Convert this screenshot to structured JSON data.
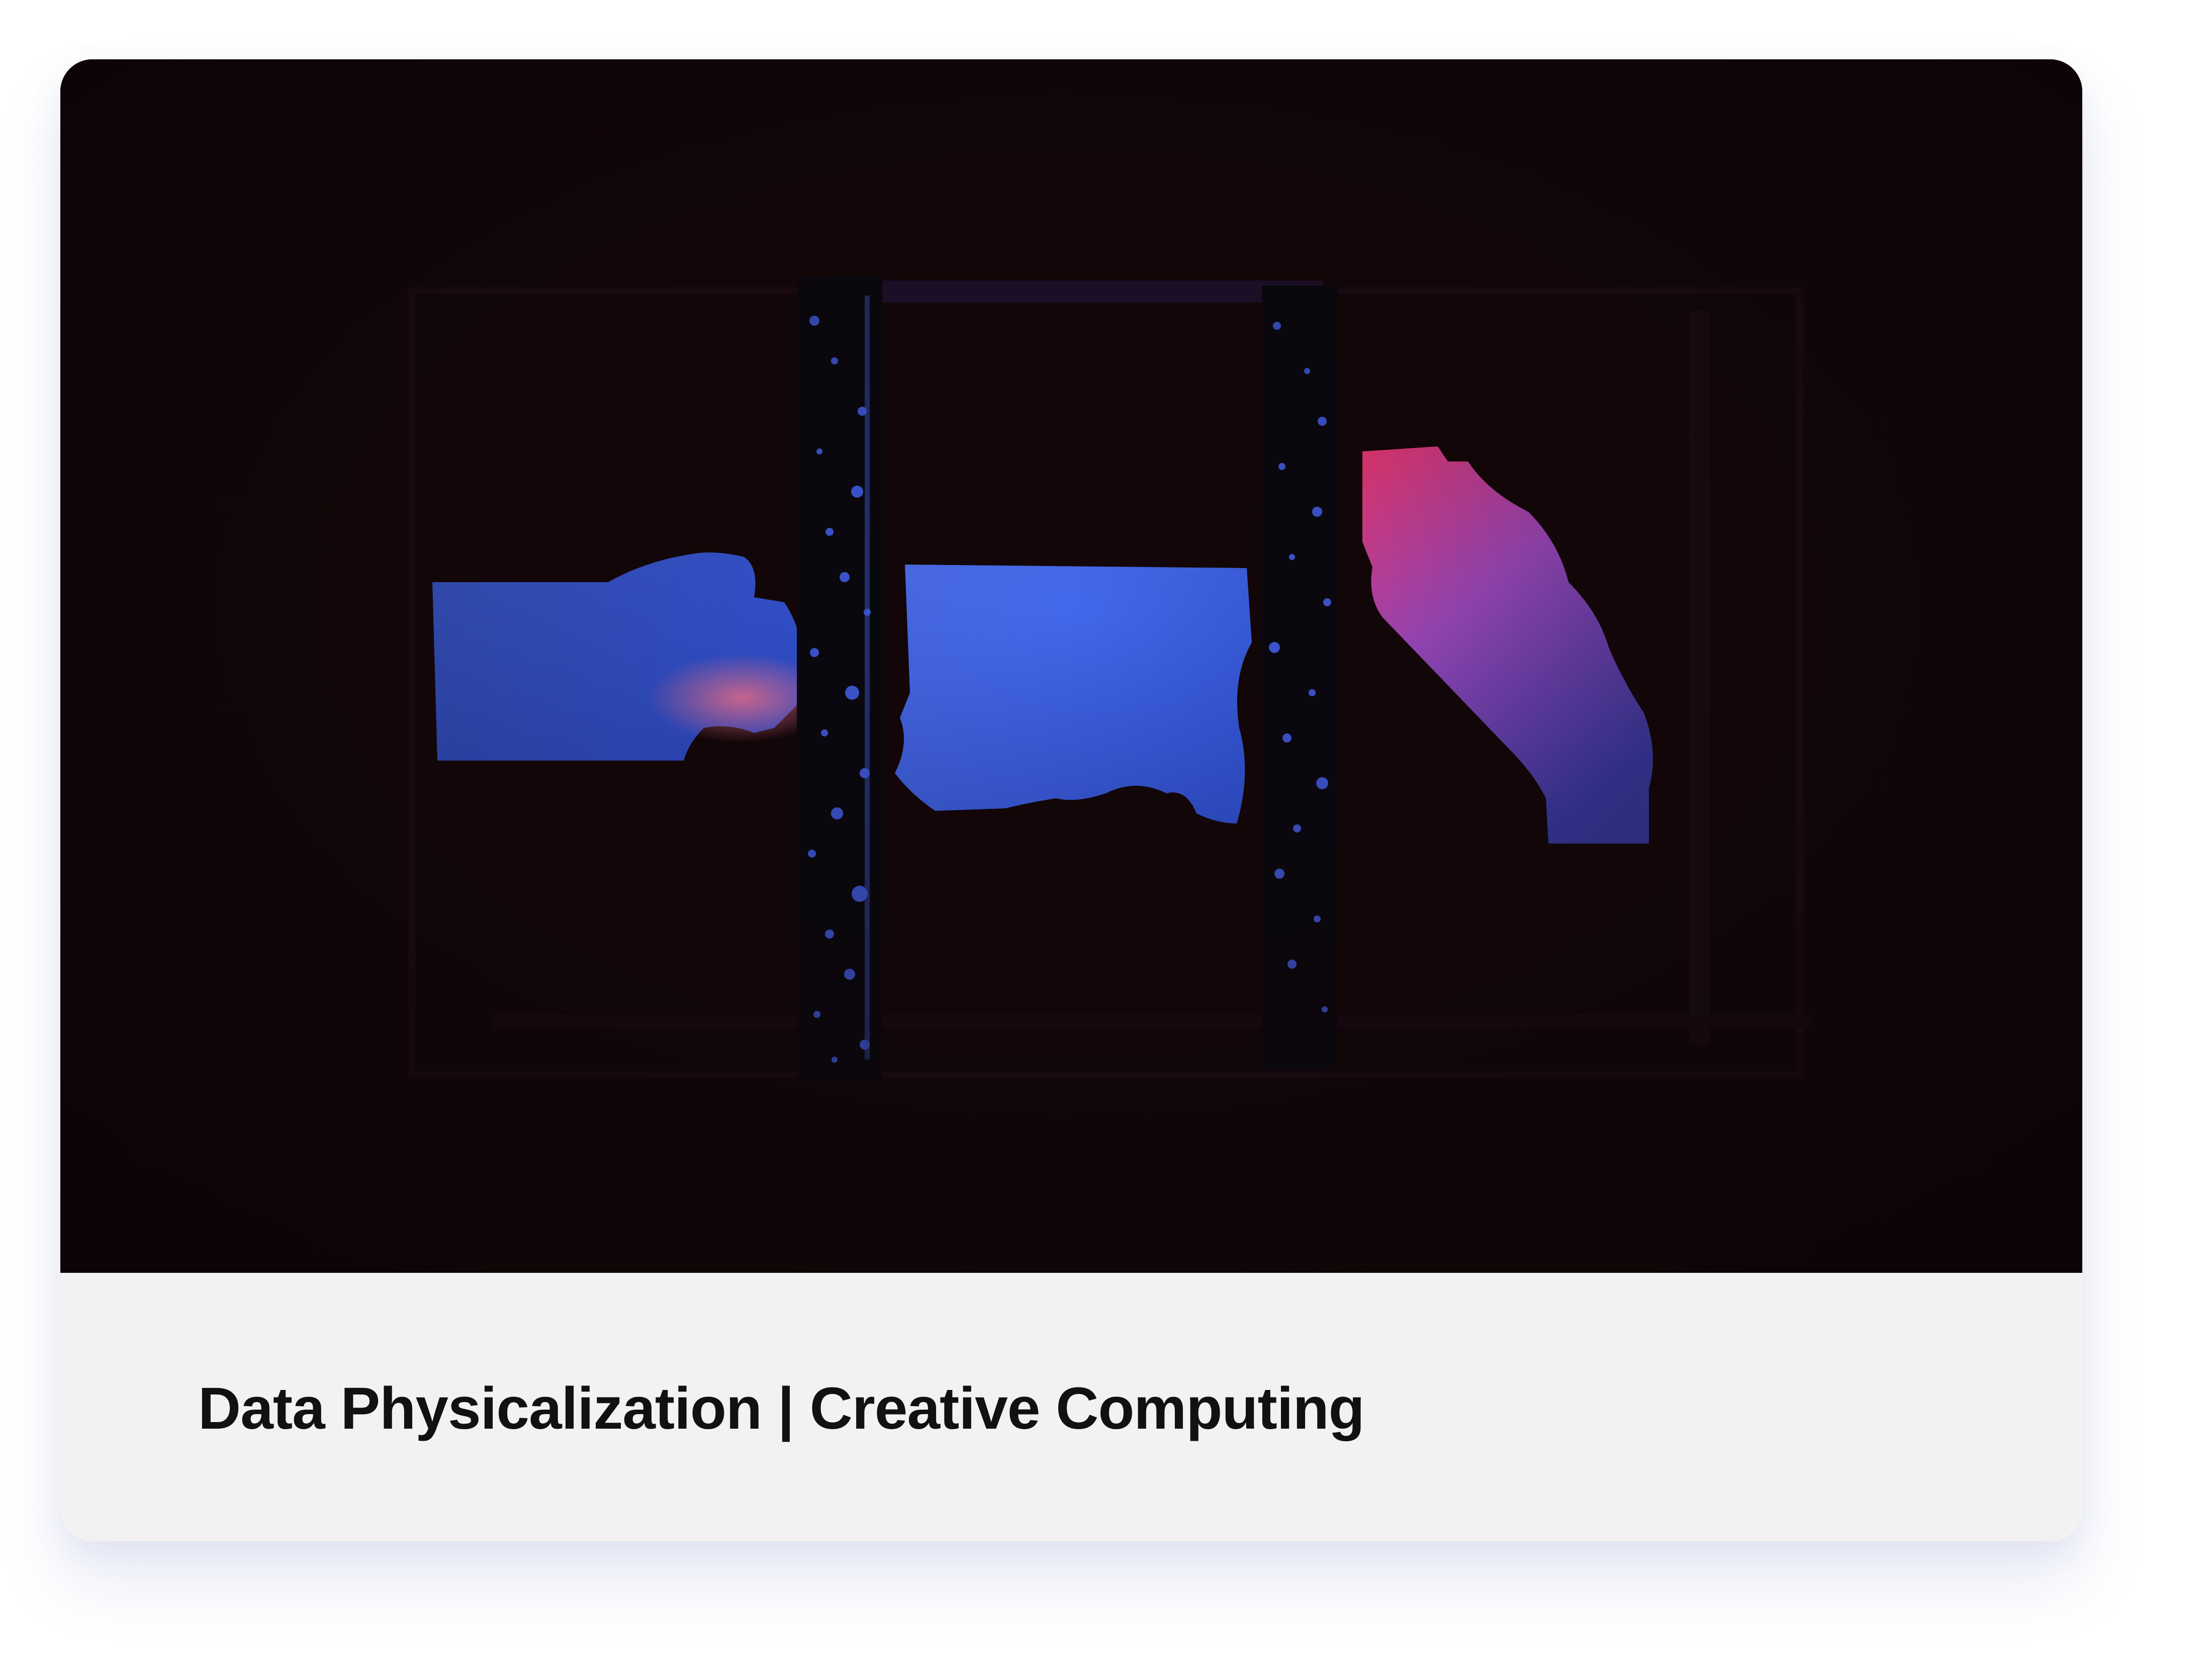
{
  "card": {
    "title": "Data Physicalization | Creative Computing",
    "image_icon": "photo-image-icon"
  },
  "colors": {
    "photo_background": "#120608",
    "caption_background": "#f2f2f3",
    "title_text": "#111111",
    "glow_blue": "#3f63e8",
    "glow_pink": "#ff4f86"
  }
}
